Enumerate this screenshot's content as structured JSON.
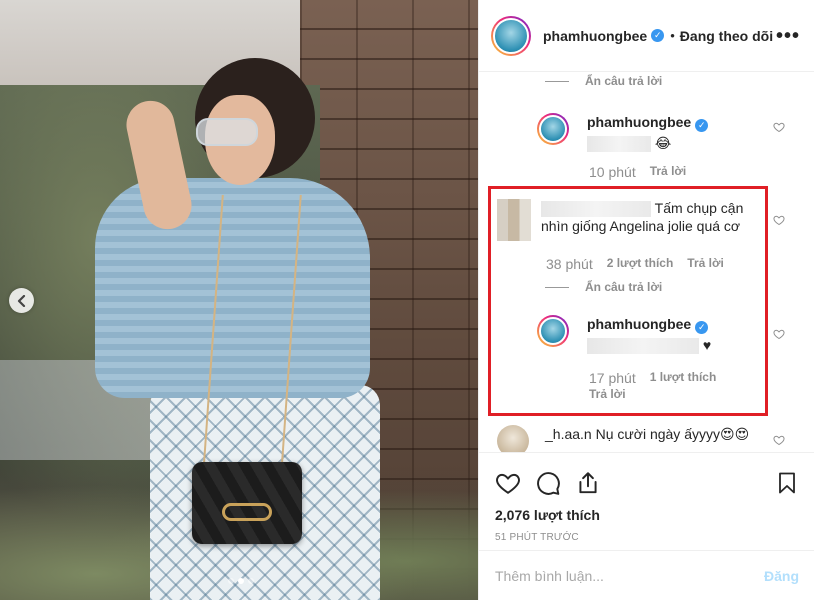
{
  "header": {
    "username": "phamhuongbee",
    "separator": "•",
    "follow_status": "Đang theo dõi",
    "more": "•••"
  },
  "comments": {
    "hide_replies_1": "Ẩn câu trả lời",
    "reply_1": {
      "username": "phamhuongbee",
      "emoji": "😂",
      "time": "10 phút",
      "reply_label": "Trả lời"
    },
    "comment_2": {
      "text": "Tấm chụp cận nhìn giống Angelina jolie quá cơ",
      "time": "38 phút",
      "likes": "2 lượt thích",
      "reply_label": "Trả lời"
    },
    "hide_replies_2": "Ẩn câu trả lời",
    "reply_2": {
      "username": "phamhuongbee",
      "emoji": "♥",
      "time": "17 phút",
      "likes": "1 lượt thích",
      "reply_label": "Trả lời"
    },
    "comment_3": {
      "username": "_h.aa.n",
      "text": "Nụ cười ngày ấyyyy😍😍"
    }
  },
  "actions": {
    "likes": "2,076 lượt thích",
    "posted": "51 phút trước"
  },
  "add_comment": {
    "placeholder": "Thêm bình luận...",
    "post": "Đăng"
  },
  "colors": {
    "verified": "#3897f0",
    "highlight_border": "#e01f26",
    "muted_text": "#8e8e8e",
    "post_disabled": "#b2dffc"
  },
  "icons": {
    "prev": "chevron-left-icon",
    "like": "heart-outline-icon",
    "comment": "speech-bubble-icon",
    "share": "share-upload-icon",
    "save": "bookmark-icon"
  }
}
